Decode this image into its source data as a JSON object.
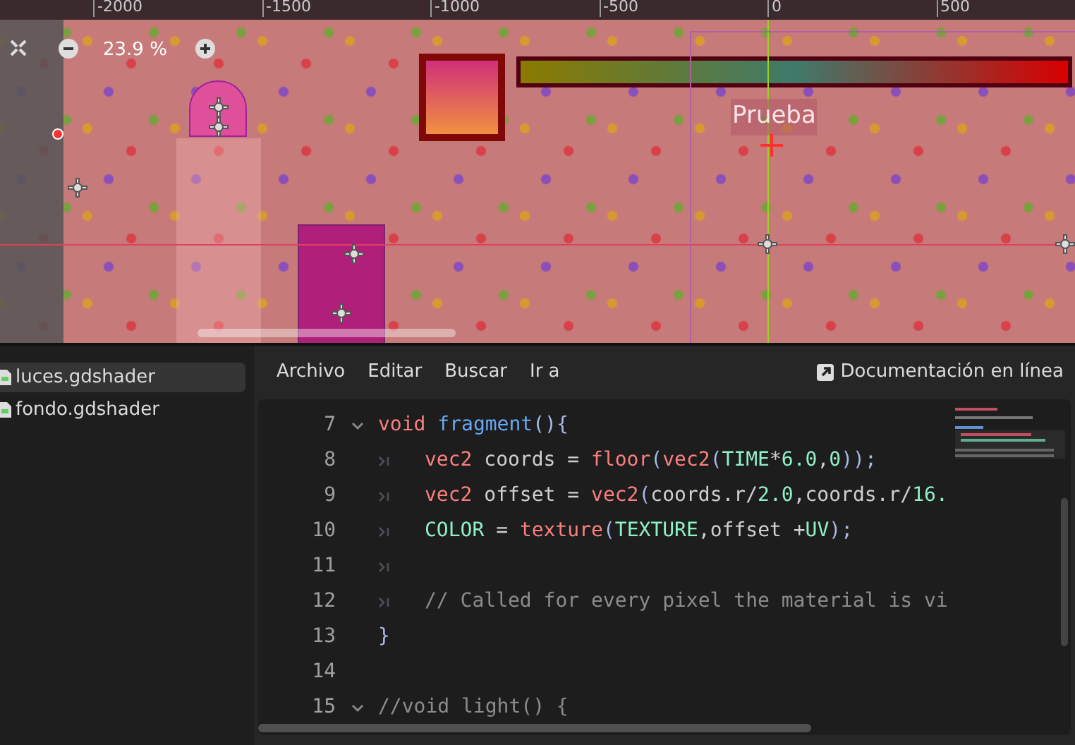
{
  "viewport": {
    "ruler_labels": [
      "-2000",
      "-1500",
      "-1000",
      "-500",
      "0",
      "500"
    ],
    "zoom": "23.9 %",
    "scene_label": "Prueba"
  },
  "files": [
    {
      "name": "luces.gdshader",
      "selected": true
    },
    {
      "name": "fondo.gdshader",
      "selected": false
    }
  ],
  "menu": [
    "Archivo",
    "Editar",
    "Buscar",
    "Ir a"
  ],
  "docs_link": "Documentación en línea",
  "code": [
    {
      "number": "7",
      "fold": true,
      "tabbed": false,
      "tokens": [
        {
          "text": "void ",
          "kind": "keyword"
        },
        {
          "text": "fragment",
          "kind": "func"
        },
        {
          "text": "(){",
          "kind": "punct"
        }
      ]
    },
    {
      "number": "8",
      "fold": false,
      "tabbed": true,
      "tokens": [
        {
          "text": "vec2",
          "kind": "keyword"
        },
        {
          "text": " coords = ",
          "kind": "plain"
        },
        {
          "text": "floor",
          "kind": "keyword"
        },
        {
          "text": "(",
          "kind": "punct"
        },
        {
          "text": "vec2",
          "kind": "keyword"
        },
        {
          "text": "(",
          "kind": "punct"
        },
        {
          "text": "TIME",
          "kind": "const"
        },
        {
          "text": "*",
          "kind": "plain"
        },
        {
          "text": "6.0",
          "kind": "const"
        },
        {
          "text": ",",
          "kind": "plain"
        },
        {
          "text": "0",
          "kind": "const"
        },
        {
          "text": "));",
          "kind": "punct"
        }
      ]
    },
    {
      "number": "9",
      "fold": false,
      "tabbed": true,
      "tokens": [
        {
          "text": "vec2",
          "kind": "keyword"
        },
        {
          "text": " offset = ",
          "kind": "plain"
        },
        {
          "text": "vec2",
          "kind": "keyword"
        },
        {
          "text": "(",
          "kind": "punct"
        },
        {
          "text": "coords.r/",
          "kind": "plain"
        },
        {
          "text": "2.0",
          "kind": "const"
        },
        {
          "text": ",coords.r/",
          "kind": "plain"
        },
        {
          "text": "16.",
          "kind": "const"
        }
      ]
    },
    {
      "number": "10",
      "fold": false,
      "tabbed": true,
      "tokens": [
        {
          "text": "COLOR",
          "kind": "const"
        },
        {
          "text": " = ",
          "kind": "plain"
        },
        {
          "text": "texture",
          "kind": "keyword"
        },
        {
          "text": "(",
          "kind": "punct"
        },
        {
          "text": "TEXTURE",
          "kind": "const"
        },
        {
          "text": ",offset +",
          "kind": "plain"
        },
        {
          "text": "UV",
          "kind": "const"
        },
        {
          "text": ");",
          "kind": "punct"
        }
      ]
    },
    {
      "number": "11",
      "fold": false,
      "tabbed": true
    },
    {
      "number": "12",
      "fold": false,
      "tabbed": true,
      "tokens": [
        {
          "text": "// Called for every pixel the material is vi",
          "kind": "comment"
        }
      ]
    },
    {
      "number": "13",
      "fold": false,
      "tabbed": false,
      "tokens": [
        {
          "text": "}",
          "kind": "punct"
        }
      ]
    },
    {
      "number": "14",
      "fold": false,
      "tabbed": false
    },
    {
      "number": "15",
      "fold": true,
      "tabbed": false,
      "tokens": [
        {
          "text": "//void light() {",
          "kind": "comment"
        }
      ]
    }
  ]
}
